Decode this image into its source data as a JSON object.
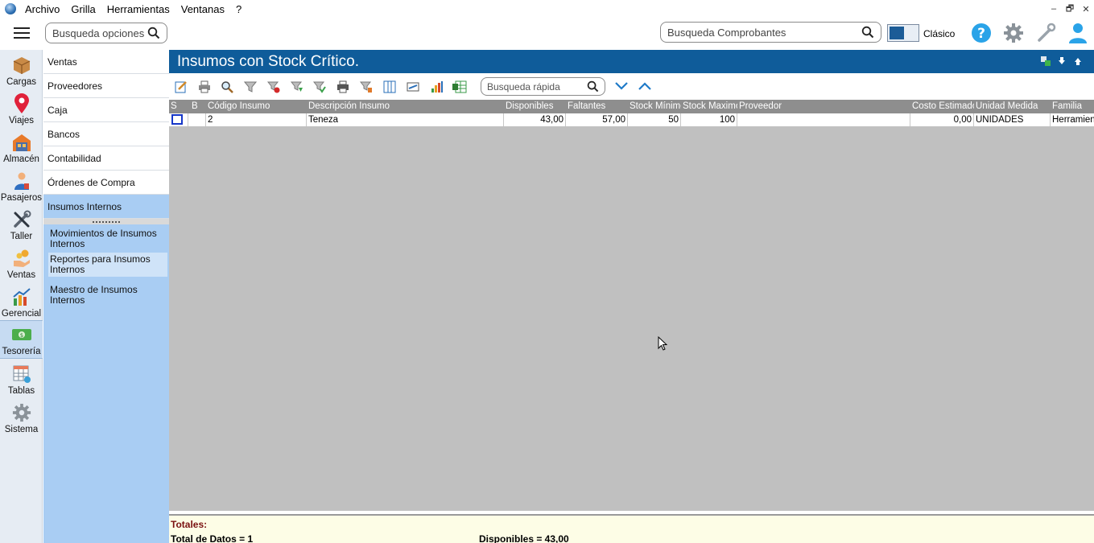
{
  "menubar": {
    "items": [
      "Archivo",
      "Grilla",
      "Herramientas",
      "Ventanas",
      "?"
    ],
    "window_controls": [
      "–",
      "🗗",
      "✕"
    ]
  },
  "topbar": {
    "search_options_placeholder": "Busqueda opciones",
    "search_vouchers_placeholder": "Busqueda Comprobantes",
    "mode_label": "Clásico"
  },
  "rail": {
    "items": [
      {
        "label": "Cargas",
        "icon": "box-icon"
      },
      {
        "label": "Viajes",
        "icon": "map-pin-icon"
      },
      {
        "label": "Almacén",
        "icon": "warehouse-icon"
      },
      {
        "label": "Pasajeros",
        "icon": "passenger-icon"
      },
      {
        "label": "Taller",
        "icon": "tools-icon"
      },
      {
        "label": "Ventas",
        "icon": "sales-icon"
      },
      {
        "label": "Gerencial",
        "icon": "chart-icon"
      },
      {
        "label": "Tesorería",
        "icon": "money-icon"
      },
      {
        "label": "Tablas",
        "icon": "table-icon"
      },
      {
        "label": "Sistema",
        "icon": "gear-icon"
      }
    ],
    "active": "Tesorería"
  },
  "nav": {
    "items": [
      "Ventas",
      "Proveedores",
      "Caja",
      "Bancos",
      "Contabilidad",
      "Órdenes de Compra",
      "Insumos Internos"
    ],
    "selected": "Insumos Internos",
    "subitems": [
      "Movimientos de Insumos Internos",
      "Reportes para Insumos Internos",
      "Maestro de Insumos Internos"
    ]
  },
  "main": {
    "title": "Insumos con Stock Crítico.",
    "quick_search_placeholder": "Busqueda rápida"
  },
  "grid": {
    "columns": [
      "S",
      "B",
      "Código Insumo",
      "Descripción Insumo",
      "Disponibles",
      "Faltantes",
      "Stock Mínimo",
      "Stock Maximo",
      "Proveedor",
      "Costo Estimado",
      "Unidad Medida",
      "Familia"
    ],
    "rows": [
      {
        "codigo": "2",
        "descripcion": "Teneza",
        "disponibles": "43,00",
        "faltantes": "57,00",
        "stock_min": "50",
        "stock_max": "100",
        "proveedor": "",
        "costo": "0,00",
        "unidad": "UNIDADES",
        "familia": "Herramientas"
      }
    ]
  },
  "totals": {
    "title": "Totales:",
    "total_datos": "Total de Datos = 1",
    "disponibles": "Disponibles = 43,00"
  },
  "colors": {
    "title_bar": "#0f5c9a",
    "nav_panel": "#a9cdf3",
    "grid_background": "#c0c0c0",
    "grid_header": "#8e8e8e",
    "totals_background": "#fdfde6",
    "totals_title": "#7a1010"
  }
}
